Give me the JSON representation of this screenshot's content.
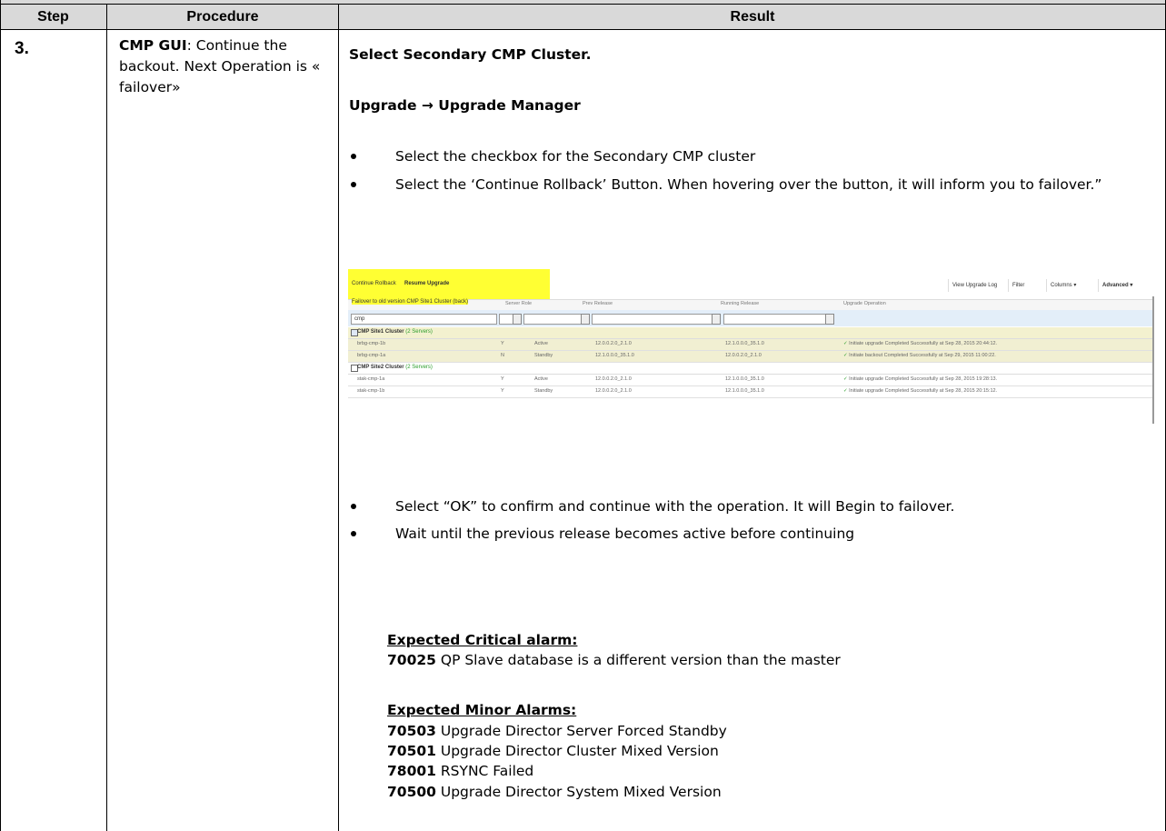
{
  "table": {
    "headers": {
      "step": "Step",
      "procedure": "Procedure",
      "result": "Result"
    }
  },
  "step": {
    "number": "3.",
    "procedure_bold": "CMP GUI",
    "procedure_text": ": Continue the backout. Next Operation is « failover»"
  },
  "result": {
    "line1": "Select Secondary CMP Cluster.",
    "nav_part1": "Upgrade ",
    "nav_arrow": "→",
    "nav_part2": " Upgrade Manager",
    "bullets_top": [
      "Select the checkbox for the Secondary CMP cluster",
      "Select the ‘Continue Rollback’ Button. When hovering over the button, it will inform you to failover.”"
    ],
    "bullets_bottom": [
      "Select “OK” to confirm and continue with the operation. It will Begin to failover.",
      "Wait until the previous release becomes active before continuing"
    ],
    "critical_title": "Expected Critical alarm:",
    "critical_alarms": [
      {
        "code": "70025",
        "text": " QP Slave database is a different version than the master"
      }
    ],
    "minor_title": "Expected Minor Alarms:",
    "minor_alarms": [
      {
        "code": "70503",
        "text": " Upgrade Director Server Forced Standby"
      },
      {
        "code": "70501",
        "text": " Upgrade Director Cluster Mixed Version"
      },
      {
        "code": "78001",
        "text": " RSYNC Failed"
      },
      {
        "code": "70500",
        "text": " Upgrade Director System Mixed Version"
      }
    ]
  },
  "screenshot": {
    "toolbar_buttons": [
      "Continue Rollback",
      "Resume Upgrade"
    ],
    "tooltip": "Failover to old version CMP Site1 Cluster (back)",
    "toolbar_right": [
      "View Upgrade Log",
      "Filter",
      "Columns ▾",
      "Advanced ▾"
    ],
    "columns": [
      "Server Role",
      "Prev Release",
      "Running Release",
      "Upgrade Operation"
    ],
    "filter_value": "cmp",
    "groups": [
      {
        "name": "CMP Site1 Cluster",
        "count": "(2 Servers)",
        "checked": true,
        "rows": [
          {
            "name": "brbg-cmp-1b",
            "y": "Y",
            "role": "Active",
            "prev": "12.0.0.2.0_2.1.0",
            "running": "12.1.0.0.0_35.1.0",
            "op": "Initiate upgrade Completed Successfully at Sep 28, 2015 20:44:12."
          },
          {
            "name": "brbg-cmp-1a",
            "y": "N",
            "role": "Standby",
            "prev": "12.1.0.0.0_35.1.0",
            "running": "12.0.0.2.0_2.1.0",
            "op": "Initiate backout Completed Successfully at Sep 29, 2015 11:00:22."
          }
        ]
      },
      {
        "name": "CMP Site2 Cluster",
        "count": "(2 Servers)",
        "checked": false,
        "rows": [
          {
            "name": "stak-cmp-1a",
            "y": "Y",
            "role": "Active",
            "prev": "12.0.0.2.0_2.1.0",
            "running": "12.1.0.0.0_35.1.0",
            "op": "Initiate upgrade Completed Successfully at Sep 28, 2015 19:28:13."
          },
          {
            "name": "stak-cmp-1b",
            "y": "Y",
            "role": "Standby",
            "prev": "12.0.0.2.0_2.1.0",
            "running": "12.1.0.0.0_35.1.0",
            "op": "Initiate upgrade Completed Successfully at Sep 28, 2015 20:15:12."
          }
        ]
      }
    ]
  }
}
